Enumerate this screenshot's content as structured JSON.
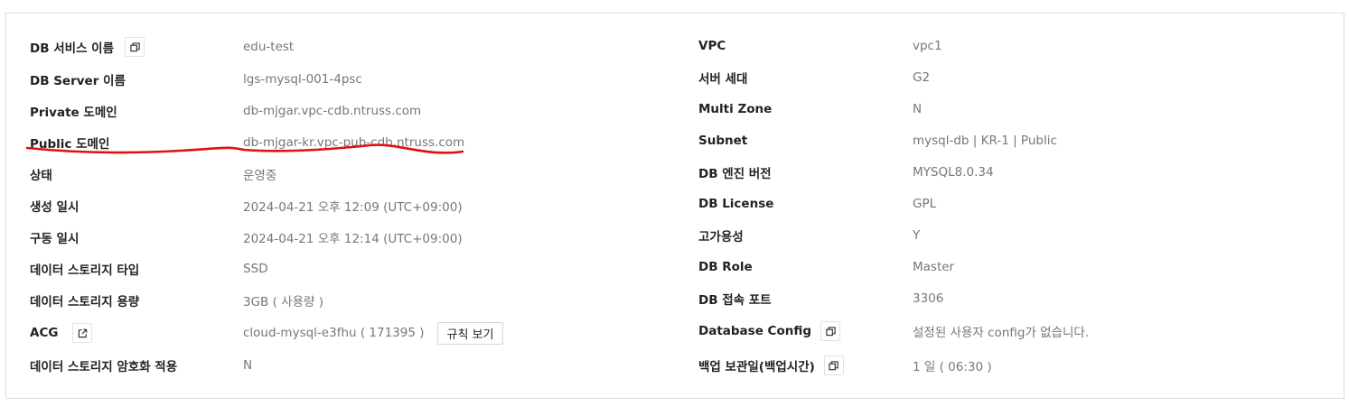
{
  "left": [
    {
      "label": "DB 서비스 이름",
      "value": "edu-test",
      "icon": "copy-icon"
    },
    {
      "label": "DB Server 이름",
      "value": "lgs-mysql-001-4psc"
    },
    {
      "label": "Private 도메인",
      "value": "db-mjgar.vpc-cdb.ntruss.com"
    },
    {
      "label": "Public 도메인",
      "value": "db-mjgar-kr.vpc-pub-cdb.ntruss.com"
    },
    {
      "label": "상태",
      "value": "운영중"
    },
    {
      "label": "생성 일시",
      "value": "2024-04-21 오후 12:09 (UTC+09:00)"
    },
    {
      "label": "구동 일시",
      "value": "2024-04-21 오후 12:14 (UTC+09:00)"
    },
    {
      "label": "데이터 스토리지 타입",
      "value": "SSD"
    },
    {
      "label": "데이터 스토리지 용량",
      "value": "3GB ( 사용량 )"
    },
    {
      "label": "ACG",
      "value": "cloud-mysql-e3fhu ( 171395 )",
      "icon": "external-link-icon",
      "button": "규칙 보기"
    },
    {
      "label": "데이터 스토리지 암호화 적용",
      "value": "N"
    }
  ],
  "right": [
    {
      "label": "VPC",
      "value": "vpc1"
    },
    {
      "label": "서버 세대",
      "value": "G2"
    },
    {
      "label": "Multi Zone",
      "value": "N"
    },
    {
      "label": "Subnet",
      "value": "mysql-db | KR-1 | Public"
    },
    {
      "label": "DB 엔진 버전",
      "value": "MYSQL8.0.34"
    },
    {
      "label": "DB License",
      "value": "GPL"
    },
    {
      "label": "고가용성",
      "value": "Y"
    },
    {
      "label": "DB Role",
      "value": "Master"
    },
    {
      "label": "DB 접속 포트",
      "value": "3306"
    },
    {
      "label": "Database Config",
      "value": "설정된 사용자 config가 없습니다.",
      "icon": "copy-icon"
    },
    {
      "label": "백업 보관일(백업시간)",
      "value": "1 일 ( 06:30 )",
      "icon": "copy-icon"
    }
  ],
  "colors": {
    "annotation": "#e01010",
    "label": "#222222",
    "value": "#777777",
    "border": "#dcdcdc"
  }
}
